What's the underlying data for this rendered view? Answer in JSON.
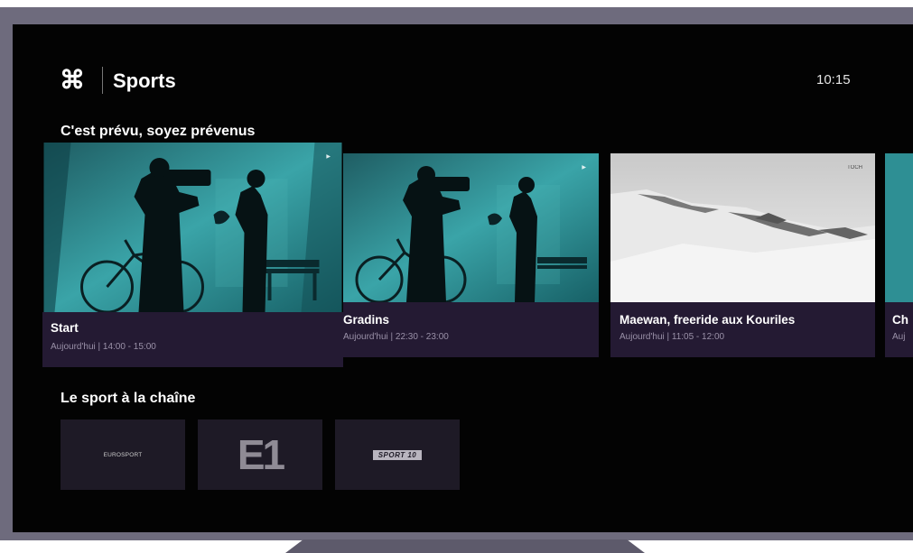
{
  "header": {
    "logo_symbol": "⌘",
    "title": "Sports",
    "clock": "10:15"
  },
  "sections": [
    {
      "title": "C'est prévu, soyez prévenus",
      "cards": [
        {
          "title": "Start",
          "subtitle": "Aujourd'hui | 14:00 - 15:00",
          "badge": "▶",
          "focused": true
        },
        {
          "title": "Gradins",
          "subtitle": "Aujourd'hui | 22:30 - 23:00",
          "badge": "▶",
          "focused": false
        },
        {
          "title": "Maewan, freeride aux Kouriles",
          "subtitle": "Aujourd'hui | 11:05 - 12:00",
          "badge": "TOCH",
          "focused": false
        },
        {
          "title": "Ch",
          "subtitle": "Auj",
          "focused": false
        }
      ]
    },
    {
      "title": "Le sport à la chaîne",
      "channels": [
        {
          "label": "EUROSPORT",
          "icon": "eurosport-logo"
        },
        {
          "label": "E1",
          "icon": "e1-logo"
        },
        {
          "label": "SPORT 10",
          "icon": "sport-logo"
        }
      ]
    }
  ],
  "colors": {
    "screen_bg": "#030303",
    "card_info_bg": "#241a33",
    "frame": "#6e6b7d",
    "teal": "#2e8f94",
    "text_secondary": "#9a91a8"
  }
}
